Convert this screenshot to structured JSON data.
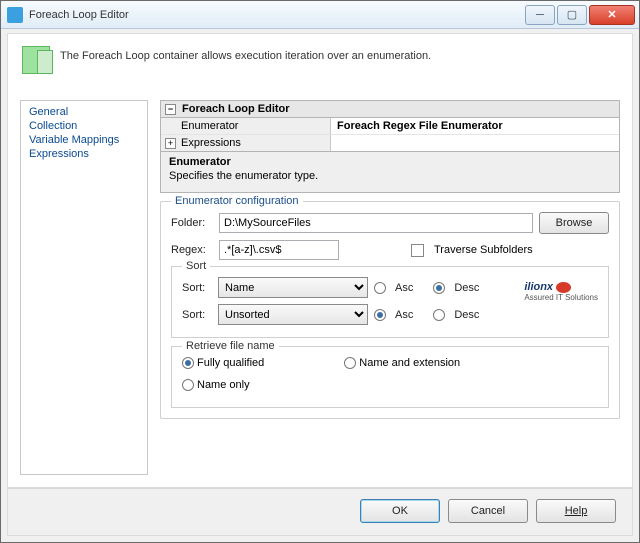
{
  "window": {
    "title": "Foreach Loop Editor"
  },
  "header": {
    "description": "The Foreach Loop container allows execution iteration over an enumeration."
  },
  "nav": {
    "items": [
      "General",
      "Collection",
      "Variable Mappings",
      "Expressions"
    ],
    "active_index": 1
  },
  "propgrid": {
    "section": "Foreach Loop Editor",
    "rows": [
      {
        "label": "Enumerator",
        "value": "Foreach Regex File Enumerator"
      },
      {
        "label": "Expressions",
        "value": ""
      }
    ],
    "desc_title": "Enumerator",
    "desc_body": "Specifies the enumerator type."
  },
  "config": {
    "legend": "Enumerator configuration",
    "folder_label": "Folder:",
    "folder_value": "D:\\MySourceFiles",
    "browse": "Browse",
    "regex_label": "Regex:",
    "regex_value": ".*[a-z]\\.csv$",
    "traverse_label": "Traverse Subfolders",
    "traverse_checked": false
  },
  "sort": {
    "legend": "Sort",
    "row_label": "Sort:",
    "primary": {
      "value": "Name",
      "asc": false,
      "desc": true
    },
    "secondary": {
      "value": "Unsorted",
      "asc": true,
      "desc": false
    },
    "asc_label": "Asc",
    "desc_label": "Desc"
  },
  "logo": {
    "name": "ilionx",
    "sub": "Assured IT Solutions"
  },
  "retrieve": {
    "legend": "Retrieve file name",
    "options": {
      "fully_qualified": "Fully qualified",
      "name_and_extension": "Name and extension",
      "name_only": "Name only"
    },
    "selected": "fully_qualified"
  },
  "footer": {
    "ok": "OK",
    "cancel": "Cancel",
    "help": "Help"
  }
}
